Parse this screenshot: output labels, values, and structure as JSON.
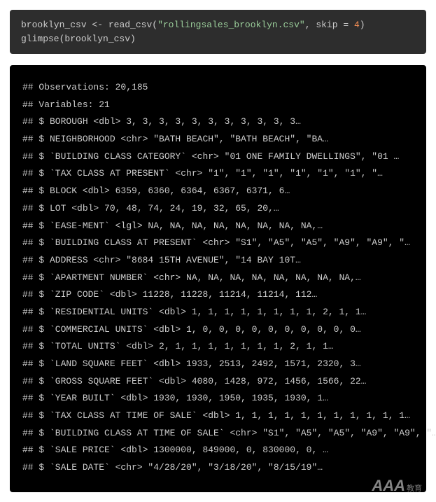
{
  "code": {
    "line1": {
      "var": "brooklyn_csv",
      "assign": " <- ",
      "func": "read_csv",
      "open": "(",
      "str": "\"rollingsales_brooklyn.csv\"",
      "comma": ", skip = ",
      "num": "4",
      "close": ")"
    },
    "line2": "glimpse(brooklyn_csv)"
  },
  "output": [
    "## Observations: 20,185",
    "## Variables: 21",
    "## $ BOROUGH <dbl> 3, 3, 3, 3, 3, 3, 3, 3, 3, 3, 3…",
    "## $ NEIGHBORHOOD <chr> \"BATH BEACH\", \"BATH BEACH\", \"BA…",
    "## $ `BUILDING CLASS CATEGORY` <chr> \"01 ONE FAMILY DWELLINGS\", \"01 …",
    "## $ `TAX CLASS AT PRESENT` <chr> \"1\", \"1\", \"1\", \"1\", \"1\", \"1\", \"…",
    "## $ BLOCK <dbl> 6359, 6360, 6364, 6367, 6371, 6…",
    "## $ LOT <dbl> 70, 48, 74, 24, 19, 32, 65, 20,…",
    "## $ `EASE-MENT` <lgl> NA, NA, NA, NA, NA, NA, NA, NA,…",
    "## $ `BUILDING CLASS AT PRESENT` <chr> \"S1\", \"A5\", \"A5\", \"A9\", \"A9\", \"…",
    "## $ ADDRESS <chr> \"8684 15TH AVENUE\", \"14 BAY 10T…",
    "## $ `APARTMENT NUMBER` <chr> NA, NA, NA, NA, NA, NA, NA, NA,…",
    "## $ `ZIP CODE` <dbl> 11228, 11228, 11214, 11214, 112…",
    "## $ `RESIDENTIAL UNITS` <dbl> 1, 1, 1, 1, 1, 1, 1, 1, 2, 1, 1…",
    "## $ `COMMERCIAL UNITS` <dbl> 1, 0, 0, 0, 0, 0, 0, 0, 0, 0, 0…",
    "## $ `TOTAL UNITS` <dbl> 2, 1, 1, 1, 1, 1, 1, 1, 2, 1, 1…",
    "## $ `LAND SQUARE FEET` <dbl> 1933, 2513, 2492, 1571, 2320, 3…",
    "## $ `GROSS SQUARE FEET` <dbl> 4080, 1428, 972, 1456, 1566, 22…",
    "## $ `YEAR BUILT` <dbl> 1930, 1930, 1950, 1935, 1930, 1…",
    "## $ `TAX CLASS AT TIME OF SALE` <dbl> 1, 1, 1, 1, 1, 1, 1, 1, 1, 1, 1…",
    "## $ `BUILDING CLASS AT TIME OF SALE` <chr> \"S1\", \"A5\", \"A5\", \"A9\", \"A9\", \"…",
    "## $ `SALE PRICE` <dbl> 1300000, 849000, 0, 830000, 0, …",
    "## $ `SALE DATE` <chr> \"4/28/20\", \"3/18/20\", \"8/15/19\"…"
  ],
  "watermark": {
    "main": "AAA",
    "sub": "教育"
  }
}
